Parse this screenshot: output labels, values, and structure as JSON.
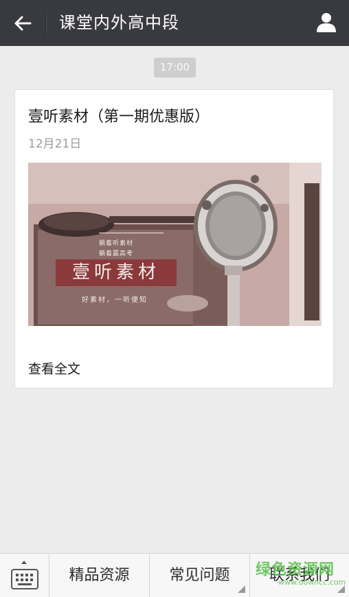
{
  "header": {
    "title": "课堂内外高中段",
    "back_icon": "arrow-left-icon",
    "profile_icon": "person-icon"
  },
  "chat": {
    "timestamp": "17:00",
    "article": {
      "title": "壹听素材（第一期优惠版）",
      "date": "12月21日",
      "cover": {
        "line1": "躺着听素材",
        "line2": "躺着赢高考",
        "banner": "壹听素材",
        "tagline": "好素材，一听便知"
      },
      "read_more": "查看全文"
    }
  },
  "bottom_menu": {
    "keyboard_icon": "keyboard-icon",
    "items": [
      {
        "label": "精品资源"
      },
      {
        "label": "常见问题"
      },
      {
        "label": "联系我们"
      }
    ]
  },
  "watermark": {
    "text": "绿色资源网",
    "url": "www.downcc.com"
  },
  "colors": {
    "header_bg": "#393a3f",
    "page_bg": "#ececec",
    "banner": "#8a3a3a",
    "watermark": "#56c24a"
  }
}
